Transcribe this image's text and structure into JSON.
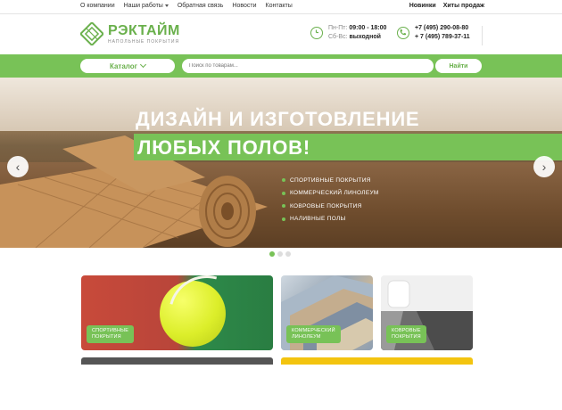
{
  "topnav": {
    "items": [
      "О компании",
      "Наши работы",
      "Обратная связь",
      "Новости",
      "Контакты"
    ],
    "right": [
      "Новинки",
      "Хиты продаж"
    ]
  },
  "header": {
    "logo_name": "РЭКТАЙМ",
    "logo_sub": "НАПОЛЬНЫЕ ПОКРЫТИЯ",
    "hours_weekday_label": "Пн-Пт:",
    "hours_weekday": "09:00 - 18:00",
    "hours_weekend_label": "Сб-Вс:",
    "hours_weekend": "выходной",
    "phone1": "+7 (495) 290-08-80",
    "phone2": "+ 7 (495) 789-37-11"
  },
  "search": {
    "catalog_label": "Каталог",
    "placeholder": "Поиск по товарам...",
    "button_label": "Найти"
  },
  "hero": {
    "title_line1": "ДИЗАЙН И ИЗГОТОВЛЕНИЕ",
    "title_line2": "ЛЮБЫХ ПОЛОВ!",
    "list": [
      "СПОРТИВНЫЕ ПОКРЫТИЯ",
      "КОММЕРЧЕСКИЙ ЛИНОЛЕУМ",
      "КОВРОВЫЕ ПОКРЫТИЯ",
      "НАЛИВНЫЕ ПОЛЫ"
    ],
    "slides_total": 3,
    "active_slide": 1
  },
  "tiles": [
    {
      "label_line1": "СПОРТИВНЫЕ",
      "label_line2": "ПОКРЫТИЯ"
    },
    {
      "label_line1": "КОММЕРЧЕСКИЙ",
      "label_line2": "ЛИНОЛЕУМ"
    },
    {
      "label_line1": "КОВРОВЫЕ",
      "label_line2": "ПОКРЫТИЯ"
    }
  ],
  "colors": {
    "brand_green": "#78c257",
    "accent_yellow": "#f3c40f"
  }
}
